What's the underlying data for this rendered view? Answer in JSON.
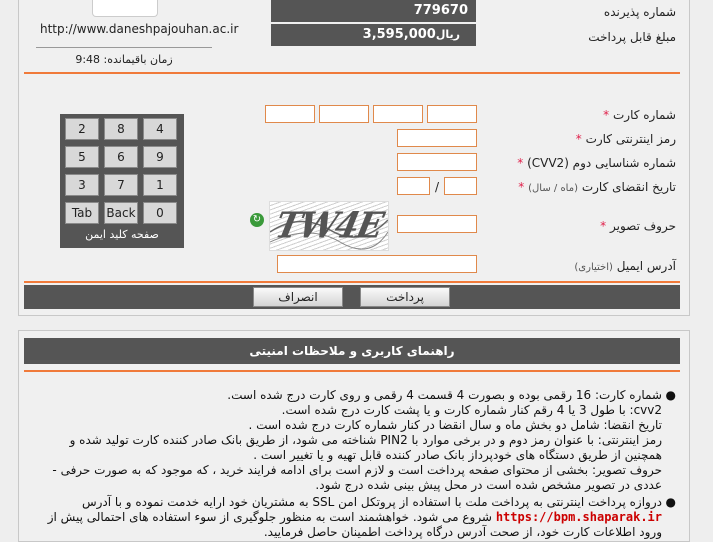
{
  "merchant": {
    "url": "http://www.daneshpajouhan.ac.ir",
    "time_remaining_label": "زمان باقیمانده:",
    "time_remaining_value": "9:48"
  },
  "summary": {
    "acceptor_label": "شماره پذیرنده",
    "acceptor_value": "779670",
    "amount_label": "مبلغ قابل پرداخت",
    "amount_value": "3,595,000",
    "amount_unit": "ریال"
  },
  "form": {
    "card_number_label": "شماره کارت",
    "pin_label": "رمز اینترنتی کارت",
    "cvv2_label": "شماره شناسایی دوم (CVV2)",
    "expiry_label": "تاریخ انقضای کارت",
    "expiry_hint": "(ماه / سال)",
    "expiry_separator": "/",
    "captcha_label": "حروف تصویر",
    "captcha_text": "TW4E",
    "email_label": "آدرس ایمیل",
    "email_hint": "(اختیاری)",
    "required_mark": "*"
  },
  "keypad": {
    "rows": [
      [
        "4",
        "8",
        "2"
      ],
      [
        "9",
        "6",
        "5"
      ],
      [
        "1",
        "7",
        "3"
      ],
      [
        "0",
        "Back",
        "Tab"
      ]
    ],
    "caption": "صفحه کلید ایمن"
  },
  "actions": {
    "pay_label": "پرداخت",
    "cancel_label": "انصراف"
  },
  "guide": {
    "title": "راهنمای کاربری و ملاحظات امنیتی",
    "paragraph1": [
      "شماره کارت: 16 رقمی بوده و بصورت 4 قسمت 4 رقمی و روی کارت درج شده است.",
      "cvv2: با طول 3 یا 4 رقم کنار شماره کارت و یا پشت کارت درج شده است.",
      "تاریخ انقضا: شامل دو بخش ماه و سال انقضا در کنار شماره کارت درج شده است .",
      "رمز اینترنتی: با عنوان رمز دوم و در برخی موارد با PIN2 شناخته می شود، از طریق بانک صادر کننده کارت تولید شده و",
      "همچنین از طریق دستگاه های خودپرداز بانک صادر کننده قابل تهیه و یا تغییر است .",
      "حروف تصویر: بخشی از محتوای صفحه پرداخت است و لازم است برای ادامه فرایند خرید ، که موجود که به صورت حرفی -",
      "عددی در تصویر مشخص شده است در محل پیش بینی شده درج شود."
    ],
    "paragraph2": [
      "دروازه پرداخت اینترنتی به پرداخت ملت با استفاده از پروتکل امن SSL به مشتریان خود ارایه خدمت نموده و با آدرس",
      "شروع می شود. خواهشمند است به منظور جلوگیری از سوء استفاده های احتمالی پیش از",
      "ورود اطلاعات کارت خود، از صحت آدرس درگاه پرداخت اطمینان حاصل فرمایید."
    ],
    "bpm_url": "https://bpm.shaparak.ir",
    "colors": {
      "header": "#555555",
      "accent": "#f07a3a",
      "link": "#cc0000"
    }
  }
}
